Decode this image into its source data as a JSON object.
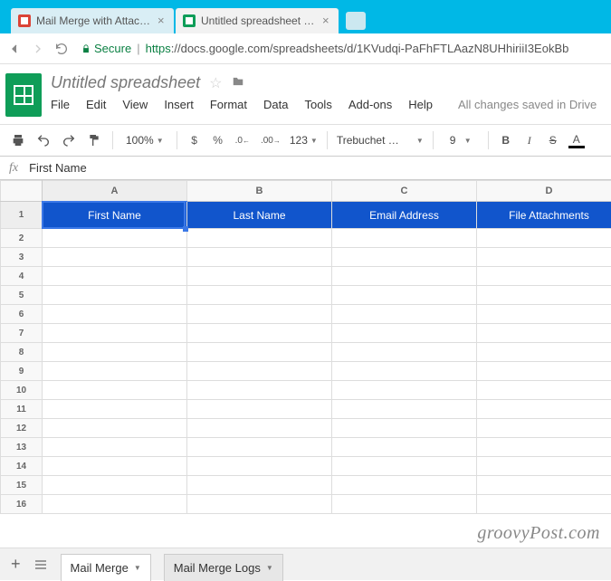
{
  "browser": {
    "tabs": [
      {
        "label": "Mail Merge with Attachm"
      },
      {
        "label": "Untitled spreadsheet - Go"
      }
    ],
    "secure_label": "Secure",
    "url_https": "https",
    "url_rest": "://docs.google.com/spreadsheets/d/1KVudqi-PaFhFTLAazN8UHhiriiI3EokBb"
  },
  "doc": {
    "title": "Untitled spreadsheet",
    "menu": [
      "File",
      "Edit",
      "View",
      "Insert",
      "Format",
      "Data",
      "Tools",
      "Add-ons",
      "Help"
    ],
    "save_msg": "All changes saved in Drive"
  },
  "toolbar": {
    "zoom": "100%",
    "currency": "$",
    "percent": "%",
    "dec_less": ".0",
    "dec_more": ".00",
    "num_format": "123",
    "font": "Trebuchet …",
    "font_size": "9",
    "bold": "B",
    "italic": "I",
    "strike": "S",
    "text_color": "A"
  },
  "fx": {
    "label": "fx",
    "value": "First Name"
  },
  "grid": {
    "cols": [
      "A",
      "B",
      "C",
      "D"
    ],
    "row_count": 16,
    "headers": [
      "First Name",
      "Last Name",
      "Email Address",
      "File Attachments"
    ]
  },
  "sheets": {
    "tabs": [
      {
        "label": "Mail Merge"
      },
      {
        "label": "Mail Merge Logs"
      }
    ]
  },
  "watermark": "groovyPost.com"
}
